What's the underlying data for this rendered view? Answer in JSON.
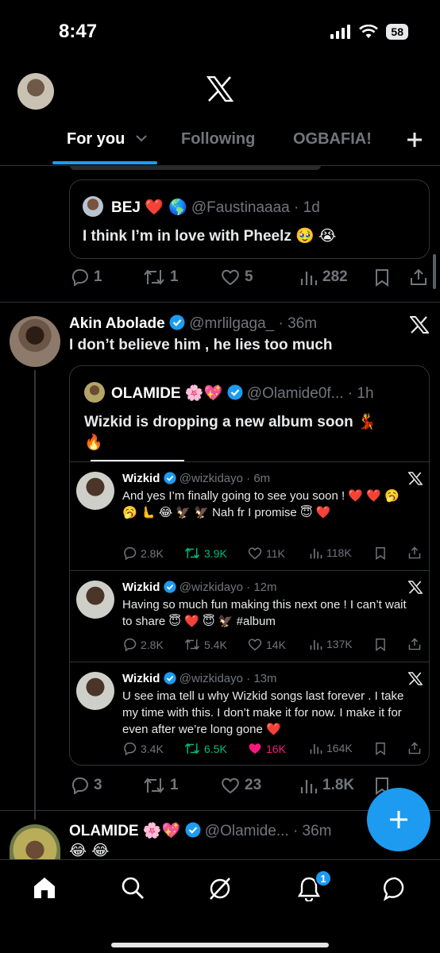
{
  "status": {
    "time": "8:47",
    "battery": "58"
  },
  "tabs": [
    {
      "label": "For you"
    },
    {
      "label": "Following"
    },
    {
      "label": "OGBAFIA!"
    }
  ],
  "tweet1": {
    "quote": {
      "name": "BEJ",
      "name_emoji": "❤️ 🌎",
      "handle": "@Faustinaaaa",
      "time": "· 1d",
      "text": "I think I’m in love with Pheelz 🥹 😭"
    },
    "stats": {
      "replies": "1",
      "retweets": "1",
      "likes": "5",
      "views": "282"
    }
  },
  "tweet2": {
    "name": "Akin Abolade",
    "handle": "@mrlilgaga_",
    "time": "· 36m",
    "text": "I don’t believe him , he lies too much",
    "quote": {
      "name": "OLAMIDE",
      "name_emoji": "🌸💖",
      "handle": "@Olamide0f...",
      "time": "· 1h",
      "text_line1": "Wizkid is dropping a new album soon 💃",
      "text_line2": "🔥",
      "subtweets": [
        {
          "name": "Wizkid",
          "handle": "@wizkidayo",
          "time": "· 6m",
          "text": "And yes I’m finally going to see you soon ! ❤️ ❤️ 🥱 🥱 🫷 😂 🦅 🦅 Nah fr I promise 😇 ❤️",
          "replies": "2.8K",
          "retweets": "3.9K",
          "likes": "11K",
          "views": "118K"
        },
        {
          "name": "Wizkid",
          "handle": "@wizkidayo",
          "time": "· 12m",
          "text": "Having so much fun making this next one ! I can’t wait to share 😇 ❤️ 😇 🦅 #album",
          "replies": "2.8K",
          "retweets": "5.4K",
          "likes": "14K",
          "views": "137K"
        },
        {
          "name": "Wizkid",
          "handle": "@wizkidayo",
          "time": "· 13m",
          "text": "U see ima tell u why Wizkid songs last forever . I take my time with this. I don’t make it for now. I make it for even after we’re long gone ❤️",
          "replies": "3.4K",
          "retweets": "6.5K",
          "likes": "16K",
          "views": "164K"
        }
      ]
    },
    "stats": {
      "replies": "3",
      "retweets": "1",
      "likes": "23",
      "views": "1.8K"
    }
  },
  "tweet3": {
    "name": "OLAMIDE",
    "name_emoji": "🌸💖",
    "handle": "@Olamide...",
    "time": "· 36m",
    "text": "😂 😂"
  },
  "nav": {
    "notifications_badge": "1"
  },
  "colors": {
    "accent": "#1d9bf0",
    "retweet_active": "#00ba7c",
    "like_active": "#f91880",
    "background": "#000000"
  }
}
